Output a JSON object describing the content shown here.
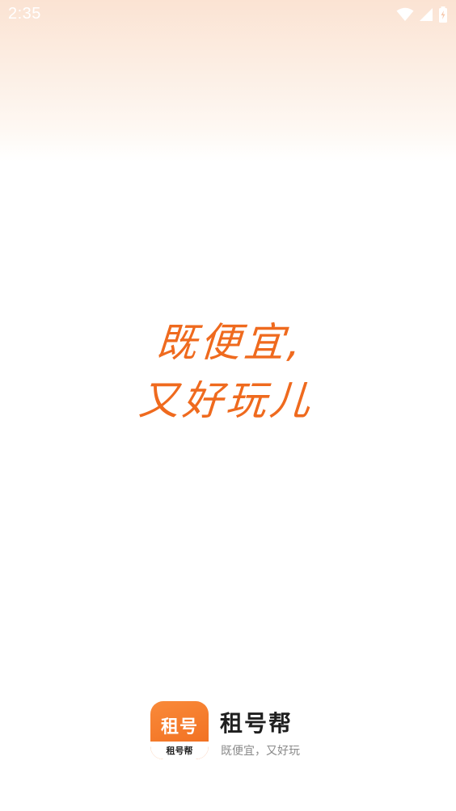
{
  "status_bar": {
    "time": "2:35",
    "icons": [
      "wifi-icon",
      "cellular-signal-icon",
      "battery-charging-icon"
    ]
  },
  "slogan": {
    "line1": "既便宜,",
    "line2": "又好玩儿",
    "color": "#ef6a1e"
  },
  "app": {
    "icon_text": "租号",
    "icon_subtext": "租号帮",
    "name": "租号帮",
    "tagline": "既便宜，又好玩",
    "accent": "#f06b1c"
  }
}
